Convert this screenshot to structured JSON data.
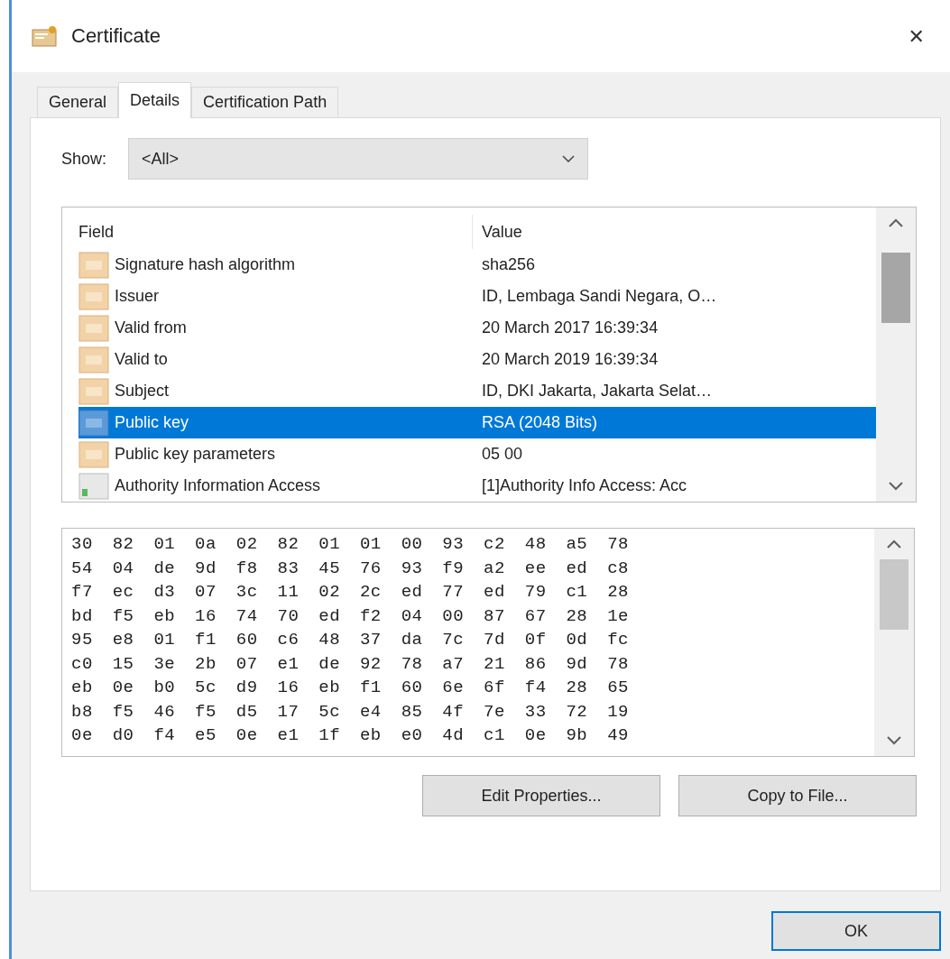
{
  "window": {
    "title": "Certificate",
    "close": "✕"
  },
  "tabs": [
    {
      "label": "General",
      "selected": false
    },
    {
      "label": "Details",
      "selected": true
    },
    {
      "label": "Certification Path",
      "selected": false
    }
  ],
  "show": {
    "label": "Show:",
    "value": "<All>"
  },
  "fields": {
    "columns": [
      "Field",
      "Value"
    ],
    "rows": [
      {
        "kind": "field",
        "field": "Signature hash algorithm",
        "value": "sha256",
        "selected": false
      },
      {
        "kind": "field",
        "field": "Issuer",
        "value": "ID, Lembaga Sandi Negara, O…",
        "selected": false
      },
      {
        "kind": "field",
        "field": "Valid from",
        "value": "20 March 2017 16:39:34",
        "selected": false
      },
      {
        "kind": "field",
        "field": "Valid to",
        "value": "20 March 2019 16:39:34",
        "selected": false
      },
      {
        "kind": "field",
        "field": "Subject",
        "value": "ID, DKI Jakarta, Jakarta Selat…",
        "selected": false
      },
      {
        "kind": "field",
        "field": "Public key",
        "value": "RSA (2048 Bits)",
        "selected": true
      },
      {
        "kind": "field",
        "field": "Public key parameters",
        "value": "05 00",
        "selected": false
      },
      {
        "kind": "extension",
        "field": "Authority Information Access",
        "value": "[1]Authority Info Access: Acc",
        "selected": false
      }
    ]
  },
  "hex_rows": [
    "30 82 01 0a 02 82 01 01 00 93 c2 48 a5 78",
    "54 04 de 9d f8 83 45 76 93 f9 a2 ee ed c8",
    "f7 ec d3 07 3c 11 02 2c ed 77 ed 79 c1 28",
    "bd f5 eb 16 74 70 ed f2 04 00 87 67 28 1e",
    "95 e8 01 f1 60 c6 48 37 da 7c 7d 0f 0d fc",
    "c0 15 3e 2b 07 e1 de 92 78 a7 21 86 9d 78",
    "eb 0e b0 5c d9 16 eb f1 60 6e 6f f4 28 65",
    "b8 f5 46 f5 d5 17 5c e4 85 4f 7e 33 72 19",
    "0e d0 f4 e5 0e e1 1f eb e0 4d c1 0e 9b 49"
  ],
  "buttons": [
    "Edit Properties...",
    "Copy to File..."
  ],
  "ok": "OK"
}
